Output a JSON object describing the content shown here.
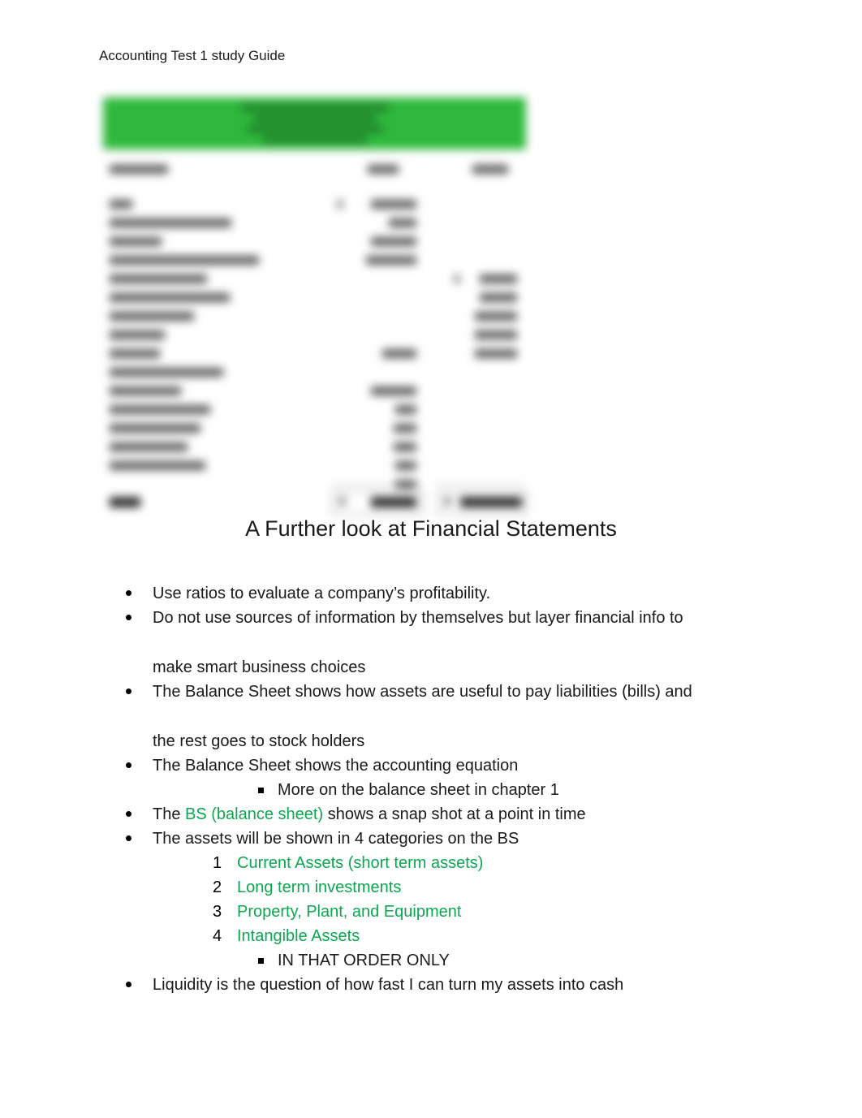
{
  "document": {
    "header": "Accounting Test 1 study Guide",
    "section_heading": "A Further look at Financial Statements"
  },
  "figure": {
    "name": "blurred-trial-balance-table",
    "title_bar_color": "#2FB83C",
    "legible": false,
    "description": "Blurred screenshot of a trial balance with a green title banner, a description column and two numeric columns, and a bold totals row",
    "column_headers": [
      "",
      "",
      ""
    ],
    "rows": [],
    "totals_row": []
  },
  "outline": {
    "items": [
      {
        "level": 1,
        "text": "Use ratios to evaluate a company’s profitability."
      },
      {
        "level": 1,
        "text": "Do not use sources of information by themselves but layer financial info to",
        "continuation": "make smart business choices"
      },
      {
        "level": 1,
        "text": "The Balance Sheet shows how assets are useful to pay liabilities (bills) and",
        "continuation": "the rest goes to stock holders"
      },
      {
        "level": 1,
        "text": "The Balance Sheet shows the accounting equation"
      },
      {
        "level": 2,
        "text": "More on the balance sheet in chapter 1"
      },
      {
        "level": 1,
        "prefix": "The ",
        "highlight": "BS (balance sheet)",
        "suffix": " shows a snap shot at a point in time"
      },
      {
        "level": 1,
        "text": "The assets will be shown in 4 categories on the BS"
      },
      {
        "level": "num",
        "number": "1",
        "text": "Current Assets (short term assets)"
      },
      {
        "level": "num",
        "number": "2",
        "text": "Long term investments"
      },
      {
        "level": "num",
        "number": "3",
        "text": "Property, Plant, and Equipment"
      },
      {
        "level": "num",
        "number": "4",
        "text": "Intangible Assets"
      },
      {
        "level": 2,
        "text": "IN THAT ORDER ONLY"
      },
      {
        "level": 1,
        "text": "Liquidity is the question of how fast I can turn my assets into cash"
      }
    ]
  },
  "colors": {
    "accent_green_text": "#0CA750",
    "banner_green": "#2FB83C",
    "body_text": "#1a1a1a"
  }
}
